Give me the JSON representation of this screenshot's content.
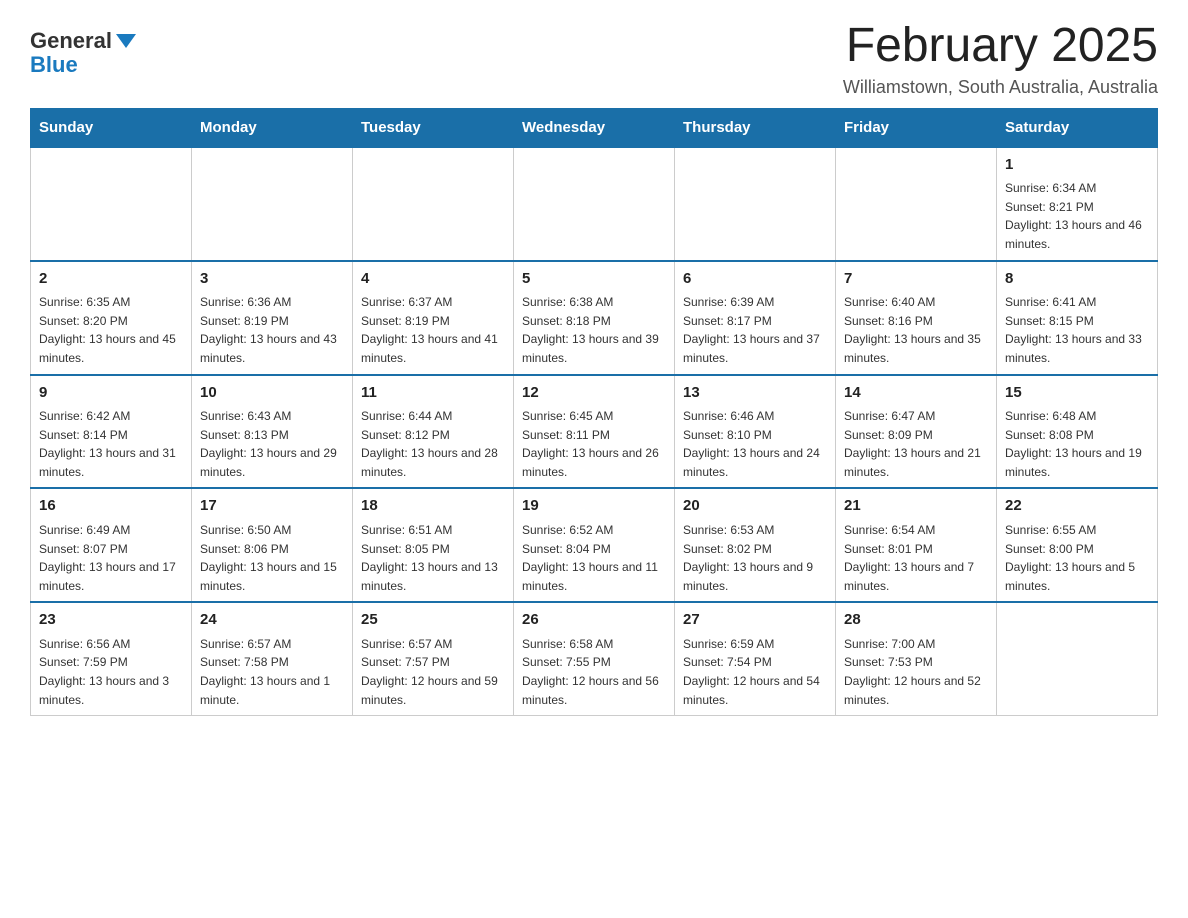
{
  "header": {
    "logo_line1": "General",
    "logo_line2": "Blue",
    "month_title": "February 2025",
    "location": "Williamstown, South Australia, Australia"
  },
  "days_of_week": [
    "Sunday",
    "Monday",
    "Tuesday",
    "Wednesday",
    "Thursday",
    "Friday",
    "Saturday"
  ],
  "weeks": [
    [
      {
        "day": "",
        "info": ""
      },
      {
        "day": "",
        "info": ""
      },
      {
        "day": "",
        "info": ""
      },
      {
        "day": "",
        "info": ""
      },
      {
        "day": "",
        "info": ""
      },
      {
        "day": "",
        "info": ""
      },
      {
        "day": "1",
        "info": "Sunrise: 6:34 AM\nSunset: 8:21 PM\nDaylight: 13 hours and 46 minutes."
      }
    ],
    [
      {
        "day": "2",
        "info": "Sunrise: 6:35 AM\nSunset: 8:20 PM\nDaylight: 13 hours and 45 minutes."
      },
      {
        "day": "3",
        "info": "Sunrise: 6:36 AM\nSunset: 8:19 PM\nDaylight: 13 hours and 43 minutes."
      },
      {
        "day": "4",
        "info": "Sunrise: 6:37 AM\nSunset: 8:19 PM\nDaylight: 13 hours and 41 minutes."
      },
      {
        "day": "5",
        "info": "Sunrise: 6:38 AM\nSunset: 8:18 PM\nDaylight: 13 hours and 39 minutes."
      },
      {
        "day": "6",
        "info": "Sunrise: 6:39 AM\nSunset: 8:17 PM\nDaylight: 13 hours and 37 minutes."
      },
      {
        "day": "7",
        "info": "Sunrise: 6:40 AM\nSunset: 8:16 PM\nDaylight: 13 hours and 35 minutes."
      },
      {
        "day": "8",
        "info": "Sunrise: 6:41 AM\nSunset: 8:15 PM\nDaylight: 13 hours and 33 minutes."
      }
    ],
    [
      {
        "day": "9",
        "info": "Sunrise: 6:42 AM\nSunset: 8:14 PM\nDaylight: 13 hours and 31 minutes."
      },
      {
        "day": "10",
        "info": "Sunrise: 6:43 AM\nSunset: 8:13 PM\nDaylight: 13 hours and 29 minutes."
      },
      {
        "day": "11",
        "info": "Sunrise: 6:44 AM\nSunset: 8:12 PM\nDaylight: 13 hours and 28 minutes."
      },
      {
        "day": "12",
        "info": "Sunrise: 6:45 AM\nSunset: 8:11 PM\nDaylight: 13 hours and 26 minutes."
      },
      {
        "day": "13",
        "info": "Sunrise: 6:46 AM\nSunset: 8:10 PM\nDaylight: 13 hours and 24 minutes."
      },
      {
        "day": "14",
        "info": "Sunrise: 6:47 AM\nSunset: 8:09 PM\nDaylight: 13 hours and 21 minutes."
      },
      {
        "day": "15",
        "info": "Sunrise: 6:48 AM\nSunset: 8:08 PM\nDaylight: 13 hours and 19 minutes."
      }
    ],
    [
      {
        "day": "16",
        "info": "Sunrise: 6:49 AM\nSunset: 8:07 PM\nDaylight: 13 hours and 17 minutes."
      },
      {
        "day": "17",
        "info": "Sunrise: 6:50 AM\nSunset: 8:06 PM\nDaylight: 13 hours and 15 minutes."
      },
      {
        "day": "18",
        "info": "Sunrise: 6:51 AM\nSunset: 8:05 PM\nDaylight: 13 hours and 13 minutes."
      },
      {
        "day": "19",
        "info": "Sunrise: 6:52 AM\nSunset: 8:04 PM\nDaylight: 13 hours and 11 minutes."
      },
      {
        "day": "20",
        "info": "Sunrise: 6:53 AM\nSunset: 8:02 PM\nDaylight: 13 hours and 9 minutes."
      },
      {
        "day": "21",
        "info": "Sunrise: 6:54 AM\nSunset: 8:01 PM\nDaylight: 13 hours and 7 minutes."
      },
      {
        "day": "22",
        "info": "Sunrise: 6:55 AM\nSunset: 8:00 PM\nDaylight: 13 hours and 5 minutes."
      }
    ],
    [
      {
        "day": "23",
        "info": "Sunrise: 6:56 AM\nSunset: 7:59 PM\nDaylight: 13 hours and 3 minutes."
      },
      {
        "day": "24",
        "info": "Sunrise: 6:57 AM\nSunset: 7:58 PM\nDaylight: 13 hours and 1 minute."
      },
      {
        "day": "25",
        "info": "Sunrise: 6:57 AM\nSunset: 7:57 PM\nDaylight: 12 hours and 59 minutes."
      },
      {
        "day": "26",
        "info": "Sunrise: 6:58 AM\nSunset: 7:55 PM\nDaylight: 12 hours and 56 minutes."
      },
      {
        "day": "27",
        "info": "Sunrise: 6:59 AM\nSunset: 7:54 PM\nDaylight: 12 hours and 54 minutes."
      },
      {
        "day": "28",
        "info": "Sunrise: 7:00 AM\nSunset: 7:53 PM\nDaylight: 12 hours and 52 minutes."
      },
      {
        "day": "",
        "info": ""
      }
    ]
  ]
}
